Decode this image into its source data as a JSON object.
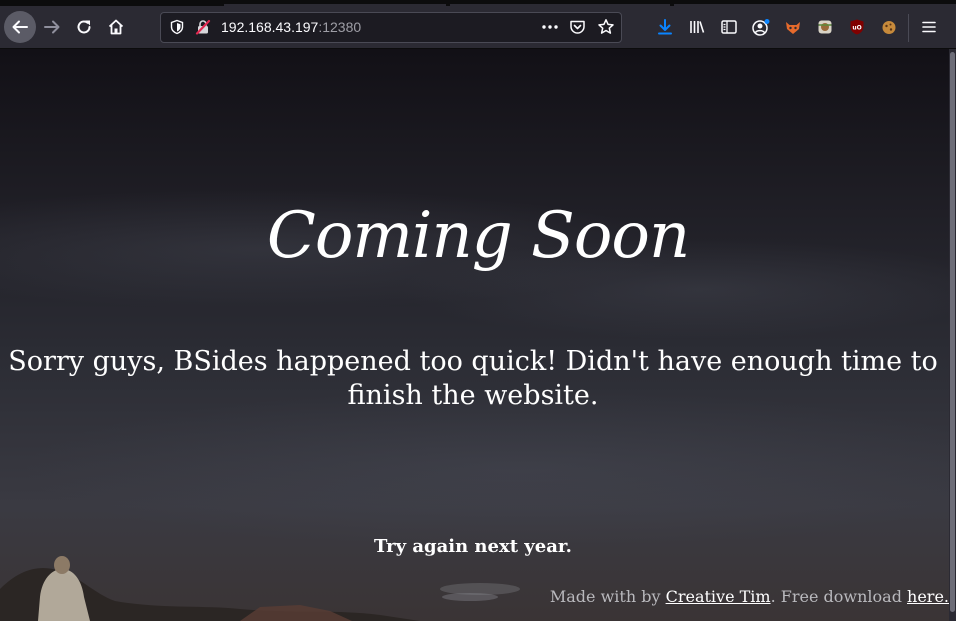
{
  "browser": {
    "url_host": "192.168.43.197",
    "url_port": ":12380",
    "icons": [
      "back-icon",
      "forward-icon",
      "reload-icon",
      "home-icon",
      "tracking-shield-icon",
      "insecure-lock-icon",
      "page-actions-icon",
      "pocket-icon",
      "bookmark-star-icon",
      "downloads-icon",
      "library-icon",
      "sidebar-icon",
      "account-icon",
      "extension-foxyproxy-icon",
      "extension-icon",
      "ublock-icon",
      "extension-cookie-icon",
      "menu-icon"
    ],
    "colors": {
      "toolbar": "#2b2a33",
      "url_bg": "#1c1b22",
      "download_accent": "#0a84ff"
    }
  },
  "page": {
    "heading": "Coming Soon",
    "message": "Sorry guys, BSides happened too quick! Didn't have enough time to finish the website.",
    "subtext": "Try again next year.",
    "footer": {
      "prefix": "Made with by ",
      "author_link": "Creative Tim",
      "middle": ". Free download ",
      "download_link": "here."
    }
  }
}
